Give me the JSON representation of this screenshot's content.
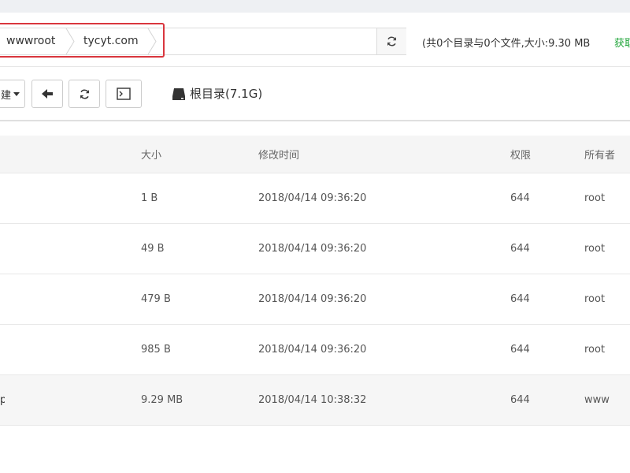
{
  "path": {
    "crumbs": [
      "wwwroot",
      "tycyt.com"
    ],
    "summary": "(共0个目录与0个文件,大小:9.30 MB",
    "summary_link": "获取"
  },
  "toolbar": {
    "dropdown_label": "建",
    "disk_label": "根目录(7.1G)"
  },
  "table": {
    "headers": {
      "size": "大小",
      "mtime": "修改时间",
      "perm": "权限",
      "owner": "所有者"
    },
    "rows": [
      {
        "name": "",
        "size": "1 B",
        "mtime": "2018/04/14 09:36:20",
        "perm": "644",
        "owner": "root"
      },
      {
        "name": "",
        "size": "49 B",
        "mtime": "2018/04/14 09:36:20",
        "perm": "644",
        "owner": "root"
      },
      {
        "name": "",
        "size": "479 B",
        "mtime": "2018/04/14 09:36:20",
        "perm": "644",
        "owner": "root"
      },
      {
        "name": "",
        "size": "985 B",
        "mtime": "2018/04/14 09:36:20",
        "perm": "644",
        "owner": "root"
      },
      {
        "name": "p",
        "size": "9.29 MB",
        "mtime": "2018/04/14 10:38:32",
        "perm": "644",
        "owner": "www"
      }
    ]
  },
  "colors": {
    "highlight_border": "#d9363e",
    "link_green": "#20a53a",
    "header_bg": "#f5f5f5"
  },
  "icons": {
    "path_refresh": "refresh-icon",
    "back": "arrow-left-icon",
    "refresh": "refresh-icon",
    "terminal": "terminal-icon",
    "disk": "hard-drive-icon"
  }
}
